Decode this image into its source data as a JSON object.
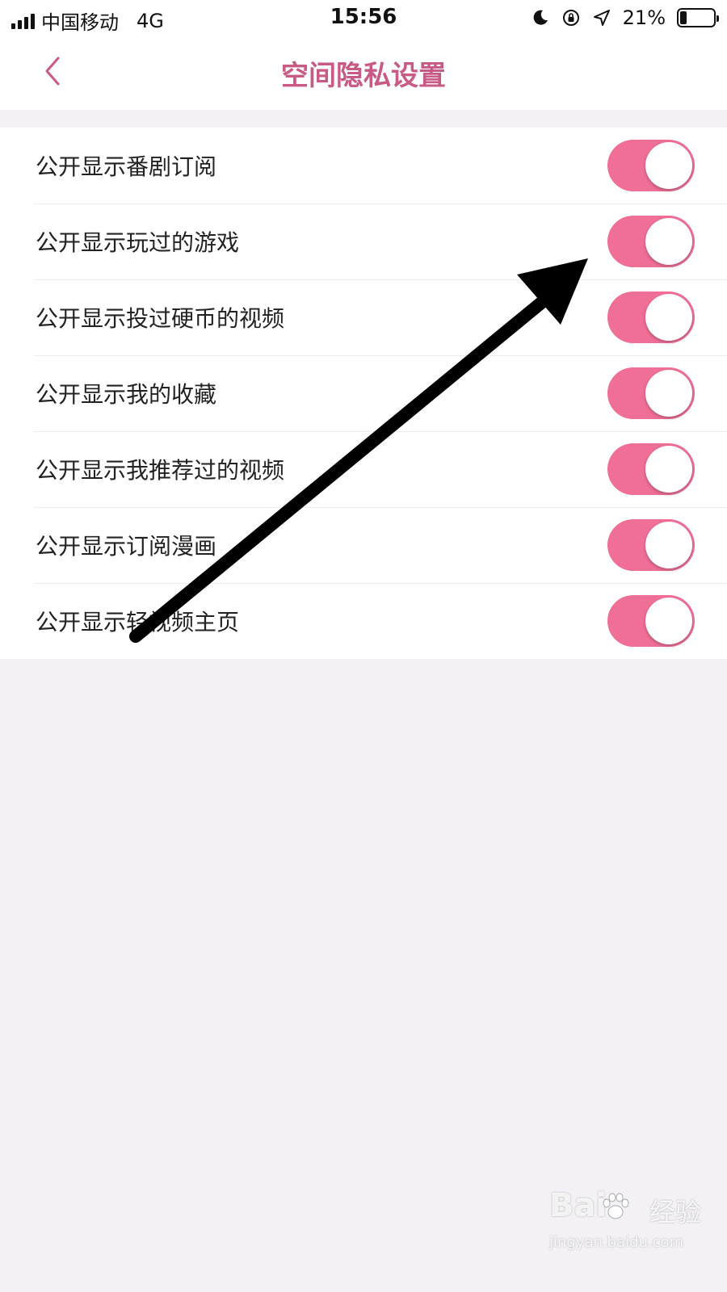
{
  "status_bar": {
    "carrier": "中国移动",
    "network": "4G",
    "time": "15:56",
    "battery_percent": "21%",
    "battery_level": 0.21,
    "icons": [
      "signal-icon",
      "moon-icon",
      "rotation-lock-icon",
      "location-icon",
      "battery-icon"
    ]
  },
  "nav": {
    "back_icon": "chevron-left-icon",
    "title": "空间隐私设置"
  },
  "settings": [
    {
      "label": "公开显示番剧订阅",
      "enabled": true
    },
    {
      "label": "公开显示玩过的游戏",
      "enabled": true
    },
    {
      "label": "公开显示投过硬币的视频",
      "enabled": true
    },
    {
      "label": "公开显示我的收藏",
      "enabled": true
    },
    {
      "label": "公开显示我推荐过的视频",
      "enabled": true
    },
    {
      "label": "公开显示订阅漫画",
      "enabled": true
    },
    {
      "label": "公开显示轻视频主页",
      "enabled": true
    }
  ],
  "watermark": {
    "brand": "Bai",
    "brand2": "经验",
    "url": "jingyan.baidu.com"
  },
  "colors": {
    "accent": "#c85a86",
    "toggle_on": "#f06f96",
    "background": "#f4f1f6",
    "annotation_arrow": "#000000"
  }
}
